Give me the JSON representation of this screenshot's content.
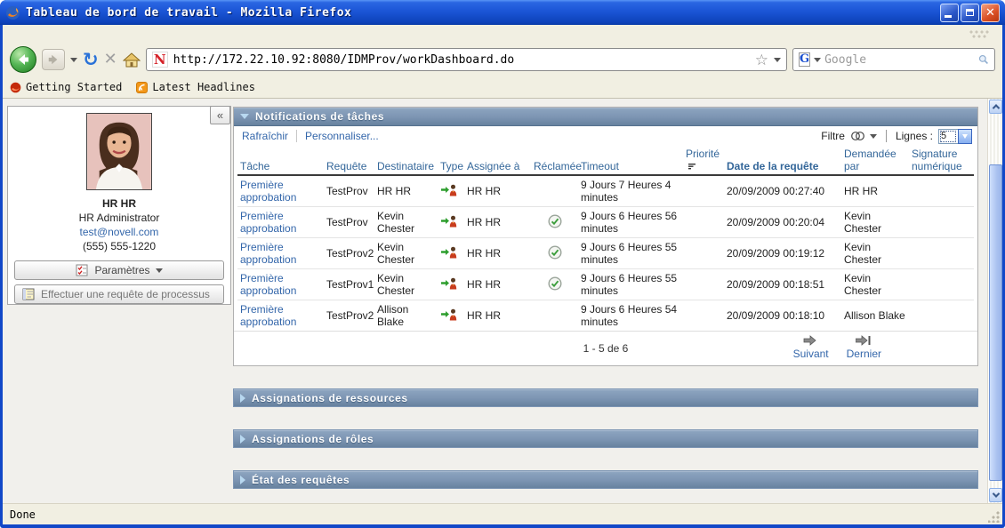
{
  "titlebar": {
    "title": "Tableau de bord de travail - Mozilla Firefox"
  },
  "toolbar": {
    "url": "http://172.22.10.92:8080/IDMProv/workDashboard.do",
    "search_placeholder": "Google"
  },
  "bookmarks_bar": {
    "items": [
      "Getting Started",
      "Latest Headlines"
    ]
  },
  "profile": {
    "name": "HR HR",
    "title": "HR Administrator",
    "email": "test@novell.com",
    "phone": "(555) 555-1220",
    "settings_label": "Paramètres",
    "process_request_label": "Effectuer une requête de processus",
    "collapse_glyph": "«"
  },
  "notifications": {
    "title": "Notifications de tâches",
    "refresh_label": "Rafraîchir",
    "personalize_label": "Personnaliser...",
    "filter_label": "Filtre",
    "rows_label": "Lignes :",
    "rows_per_page": "5",
    "columns": [
      "Tâche",
      "Requête",
      "Destinataire",
      "Type",
      "Assignée à",
      "Réclamée",
      "Timeout",
      "Priorité",
      "Date de la requête",
      "Demandée par",
      "Signature numérique"
    ],
    "rows": [
      {
        "task": "Première approbation",
        "request": "TestProv",
        "recipient": "HR HR",
        "assigned_to": "HR HR",
        "claimed": false,
        "timeout": "9 Jours 7 Heures 4 minutes",
        "priority": "",
        "date": "20/09/2009 00:27:40",
        "requested_by": "HR HR",
        "signature": ""
      },
      {
        "task": "Première approbation",
        "request": "TestProv",
        "recipient": "Kevin Chester",
        "assigned_to": "HR HR",
        "claimed": true,
        "timeout": "9 Jours 6 Heures 56 minutes",
        "priority": "",
        "date": "20/09/2009 00:20:04",
        "requested_by": "Kevin Chester",
        "signature": ""
      },
      {
        "task": "Première approbation",
        "request": "TestProv2",
        "recipient": "Kevin Chester",
        "assigned_to": "HR HR",
        "claimed": true,
        "timeout": "9 Jours 6 Heures 55 minutes",
        "priority": "",
        "date": "20/09/2009 00:19:12",
        "requested_by": "Kevin Chester",
        "signature": ""
      },
      {
        "task": "Première approbation",
        "request": "TestProv1",
        "recipient": "Kevin Chester",
        "assigned_to": "HR HR",
        "claimed": true,
        "timeout": "9 Jours 6 Heures 55 minutes",
        "priority": "",
        "date": "20/09/2009 00:18:51",
        "requested_by": "Kevin Chester",
        "signature": ""
      },
      {
        "task": "Première approbation",
        "request": "TestProv2",
        "recipient": "Allison Blake",
        "assigned_to": "HR HR",
        "claimed": false,
        "timeout": "9 Jours 6 Heures 54 minutes",
        "priority": "",
        "date": "20/09/2009 00:18:10",
        "requested_by": "Allison Blake",
        "signature": ""
      }
    ],
    "pagination": {
      "range_text": "1 - 5 de 6",
      "next_label": "Suivant",
      "last_label": "Dernier"
    }
  },
  "sections": [
    "Assignations de ressources",
    "Assignations de rôles",
    "État des requêtes"
  ],
  "statusbar": {
    "text": "Done"
  },
  "colors": {
    "link": "#3366aa",
    "header_text": "#336699",
    "claimed_green": "#3c9e3c",
    "titlebar_blue": "#1b55d6"
  }
}
